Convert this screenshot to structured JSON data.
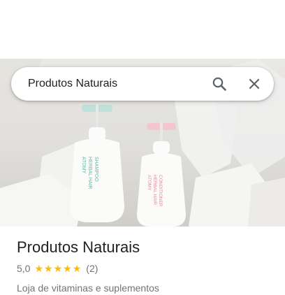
{
  "search": {
    "query": "Produtos Naturais"
  },
  "hero_image": {
    "bottle_left": {
      "brand": "ATOMY",
      "line1": "HERBAL HAIR",
      "line2": "SHAMPOO"
    },
    "bottle_right": {
      "brand": "ATOMY",
      "line1": "HERBAL HAIR",
      "line2": "CONDITIONER"
    }
  },
  "place": {
    "title": "Produtos Naturais",
    "rating": "5,0",
    "stars": 5,
    "review_count": "(2)",
    "category": "Loja de vitaminas e suplementos"
  },
  "colors": {
    "star": "#fbbc04",
    "title": "#202124",
    "secondary_text": "#70757a",
    "icon": "#5f6368"
  },
  "icons": {
    "search": "search-icon",
    "close": "close-icon",
    "star": "star-icon"
  }
}
